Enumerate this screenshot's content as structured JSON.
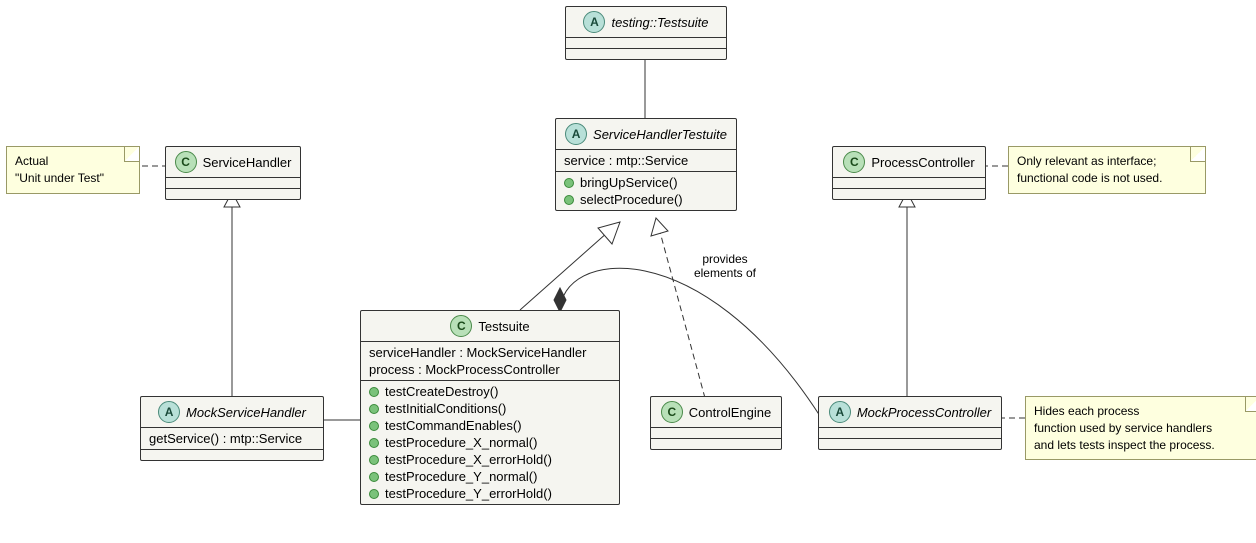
{
  "classes": {
    "testing_testsuite": {
      "stereo": "A",
      "name": "testing::Testsuite",
      "italic": true
    },
    "service_handler": {
      "stereo": "C",
      "name": "ServiceHandler",
      "italic": false
    },
    "service_handler_testsuite": {
      "stereo": "A",
      "name": "ServiceHandlerTestuite",
      "italic": true,
      "attrs": [
        "service : mtp::Service"
      ],
      "methods": [
        "bringUpService()",
        "selectProcedure()"
      ]
    },
    "process_controller": {
      "stereo": "C",
      "name": "ProcessController",
      "italic": false
    },
    "mock_service_handler": {
      "stereo": "A",
      "name": "MockServiceHandler",
      "italic": true,
      "attrs": [
        "getService() : mtp::Service"
      ]
    },
    "testsuite": {
      "stereo": "C",
      "name": "Testsuite",
      "italic": false,
      "attrs": [
        "serviceHandler : MockServiceHandler",
        "process : MockProcessController"
      ],
      "methods": [
        "testCreateDestroy()",
        "testInitialConditions()",
        "testCommandEnables()",
        "testProcedure_X_normal()",
        "testProcedure_X_errorHold()",
        "testProcedure_Y_normal()",
        "testProcedure_Y_errorHold()"
      ]
    },
    "control_engine": {
      "stereo": "C",
      "name": "ControlEngine",
      "italic": false
    },
    "mock_process_controller": {
      "stereo": "A",
      "name": "MockProcessController",
      "italic": true
    }
  },
  "notes": {
    "note_uut": {
      "lines": [
        "Actual",
        "\"Unit under Test\""
      ]
    },
    "note_pc": {
      "lines": [
        "Only relevant as interface;",
        "functional code is not used."
      ]
    },
    "note_mpc": {
      "lines": [
        "Hides each process",
        "function used by service handlers",
        "and lets tests inspect the process."
      ]
    }
  },
  "edge_labels": {
    "provides": "provides\nelements of"
  }
}
